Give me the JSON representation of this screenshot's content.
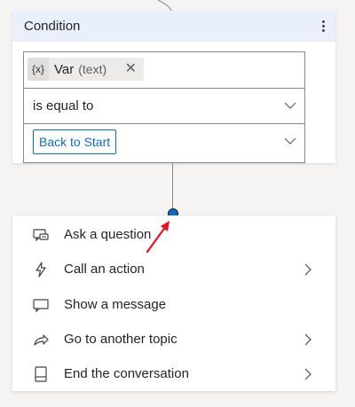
{
  "condition": {
    "title": "Condition",
    "variable": {
      "icon_text": "{x}",
      "name": "Var",
      "type": "(text)",
      "remove_symbol": "✕"
    },
    "operator": "is equal to",
    "value": "Back to Start"
  },
  "menu": {
    "items": [
      {
        "label": "Ask a question",
        "icon": "ask-question-icon",
        "has_submenu": false
      },
      {
        "label": "Call an action",
        "icon": "lightning-icon",
        "has_submenu": true
      },
      {
        "label": "Show a message",
        "icon": "message-icon",
        "has_submenu": false
      },
      {
        "label": "Go to another topic",
        "icon": "redirect-arrow-icon",
        "has_submenu": true
      },
      {
        "label": "End the conversation",
        "icon": "end-conversation-icon",
        "has_submenu": true
      }
    ]
  },
  "colors": {
    "header_bg": "#e9f0fb",
    "accent": "#0f6cbd",
    "annotation_arrow": "#e81123"
  }
}
